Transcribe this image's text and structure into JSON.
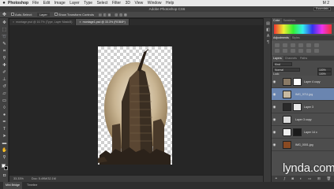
{
  "menubar": {
    "apple": "",
    "app": "Photoshop",
    "items": [
      "File",
      "Edit",
      "Image",
      "Layer",
      "Type",
      "Select",
      "Filter",
      "3D",
      "View",
      "Window",
      "Help"
    ],
    "right": "M 2"
  },
  "titlebar": {
    "title": "Adobe Photoshop CS6",
    "workspace": "Essentials"
  },
  "options": {
    "auto_select": "Auto-Select:",
    "auto_select_value": "Layer",
    "show_transform": "Show Transform Controls"
  },
  "tabs": [
    {
      "label": "montage.psd @ 16.7% (Type, Layer Mask/8)"
    },
    {
      "label": "montage1.psd @ 33.3% (RGB/8*)"
    }
  ],
  "status": {
    "zoom": "33.33%",
    "doc": "Doc: 5.49M/32.1M"
  },
  "bottom_tabs": [
    "Mini Bridge",
    "Timeline"
  ],
  "panels": {
    "top_tabs": [
      "Color",
      "Swatches"
    ],
    "adj_tabs": [
      "Adjustments",
      "Styles"
    ],
    "adj_title": "Add an adjustment",
    "layer_tabs": [
      "Layers",
      "Channels",
      "Paths"
    ],
    "kind": "Kind",
    "blend": "Normal",
    "opacity": "100%",
    "lock": "Lock:",
    "fill": "100%",
    "layers": [
      {
        "name": "Layer 4 copy"
      },
      {
        "name": "IMG_9711.jpg"
      },
      {
        "name": "Layer 3"
      },
      {
        "name": "Layer 3 copy"
      },
      {
        "name": "Layer 14 c"
      },
      {
        "name": "IMG_0001.jpg"
      }
    ],
    "footer_icons": [
      "link-icon",
      "fx-icon",
      "mask-icon",
      "adjust-icon",
      "folder-icon",
      "new-layer-icon",
      "trash-icon"
    ]
  },
  "watermark": {
    "text": "lynda",
    "suffix": ".com"
  },
  "colors": {
    "accent_selected": "#6a85b0",
    "ui_dark": "#262626",
    "panel": "#4a4a4a"
  }
}
